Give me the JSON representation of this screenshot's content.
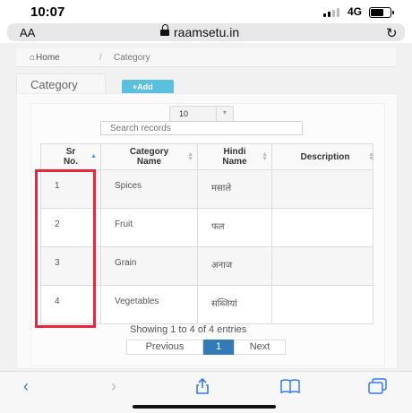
{
  "status_bar": {
    "time": "10:07",
    "network": "4G"
  },
  "browser": {
    "aa_label": "AA",
    "domain": "raamsetu.in"
  },
  "breadcrumb": {
    "home": "Home",
    "separator": "/",
    "current": "Category"
  },
  "page": {
    "tab_label": "Category",
    "add_button": "+Add"
  },
  "table_controls": {
    "page_length": "10",
    "search_placeholder": "Search records"
  },
  "table": {
    "headers": {
      "sr": "Sr No.",
      "category": "Category Name",
      "hindi": "Hindi Name",
      "description": "Description"
    },
    "rows": [
      {
        "sr": "1",
        "category": "Spices",
        "hindi": "मसाले",
        "description": ""
      },
      {
        "sr": "2",
        "category": "Fruit",
        "hindi": "फल",
        "description": ""
      },
      {
        "sr": "3",
        "category": "Grain",
        "hindi": "अनाज",
        "description": ""
      },
      {
        "sr": "4",
        "category": "Vegetables",
        "hindi": "सब्जियां",
        "description": ""
      }
    ]
  },
  "footer": {
    "info": "Showing 1 to 4 of 4 entries",
    "prev": "Previous",
    "page": "1",
    "next": "Next"
  },
  "icons": [
    "back-icon",
    "forward-icon",
    "share-icon",
    "bookmarks-icon",
    "tabs-icon",
    "reload-icon",
    "lock-icon",
    "home-icon"
  ],
  "colors": {
    "add_button": "#5bc0de",
    "active_page": "#337ab7",
    "highlight_box": "#e5283d",
    "toolbar_icon": "#3478f6"
  }
}
